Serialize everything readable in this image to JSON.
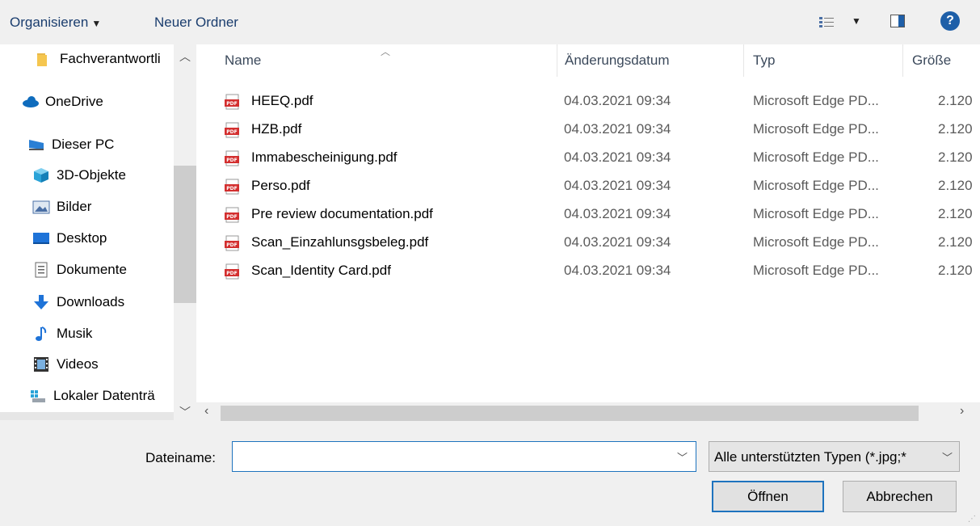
{
  "toolbar": {
    "organize_label": "Organisieren",
    "new_folder_label": "Neuer Ordner",
    "help_label": "?"
  },
  "nav": {
    "items": [
      {
        "label": "Fachverantwortli",
        "icon": "folder-icon"
      },
      {
        "label": "OneDrive",
        "icon": "onedrive-icon"
      },
      {
        "label": "Dieser PC",
        "icon": "computer-icon"
      },
      {
        "label": "3D-Objekte",
        "icon": "3d-objects-icon"
      },
      {
        "label": "Bilder",
        "icon": "pictures-icon"
      },
      {
        "label": "Desktop",
        "icon": "desktop-icon"
      },
      {
        "label": "Dokumente",
        "icon": "documents-icon"
      },
      {
        "label": "Downloads",
        "icon": "downloads-icon"
      },
      {
        "label": "Musik",
        "icon": "music-icon"
      },
      {
        "label": "Videos",
        "icon": "videos-icon"
      },
      {
        "label": "Lokaler Datenträ",
        "icon": "local-disk-icon"
      }
    ]
  },
  "columns": {
    "name": "Name",
    "date": "Änderungsdatum",
    "type": "Typ",
    "size": "Größe"
  },
  "files": [
    {
      "name": "HEEQ.pdf",
      "date": "04.03.2021 09:34",
      "type": "Microsoft Edge PD...",
      "size": "2.120"
    },
    {
      "name": "HZB.pdf",
      "date": "04.03.2021 09:34",
      "type": "Microsoft Edge PD...",
      "size": "2.120"
    },
    {
      "name": "Immabescheinigung.pdf",
      "date": "04.03.2021 09:34",
      "type": "Microsoft Edge PD...",
      "size": "2.120"
    },
    {
      "name": "Perso.pdf",
      "date": "04.03.2021 09:34",
      "type": "Microsoft Edge PD...",
      "size": "2.120"
    },
    {
      "name": "Pre review documentation.pdf",
      "date": "04.03.2021 09:34",
      "type": "Microsoft Edge PD...",
      "size": "2.120"
    },
    {
      "name": "Scan_Einzahlunsgsbeleg.pdf",
      "date": "04.03.2021 09:34",
      "type": "Microsoft Edge PD...",
      "size": "2.120"
    },
    {
      "name": "Scan_Identity Card.pdf",
      "date": "04.03.2021 09:34",
      "type": "Microsoft Edge PD...",
      "size": "2.120"
    }
  ],
  "bottom": {
    "filename_label": "Dateiname:",
    "filename_value": "",
    "filetype_value": "Alle unterstützten Typen (*.jpg;*",
    "open_label": "Öffnen",
    "cancel_label": "Abbrechen"
  },
  "colors": {
    "accent": "#1e73be",
    "toolbar_text": "#1a3d6e",
    "pdf_red": "#d32f2f"
  }
}
